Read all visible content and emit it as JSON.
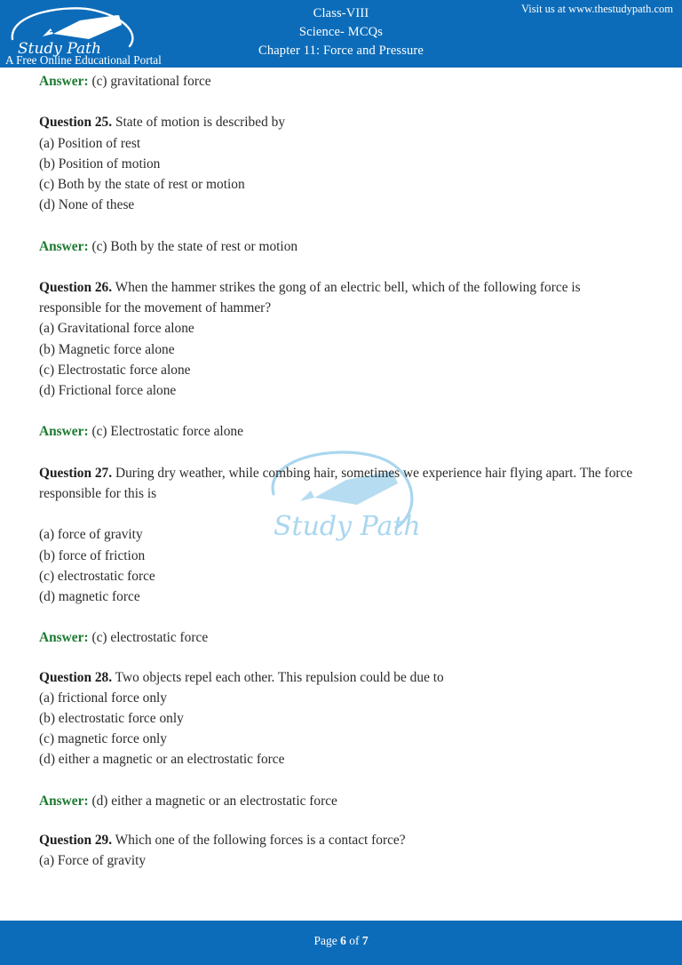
{
  "header": {
    "logo": {
      "brand": "Study Path",
      "tagline": "A Free Online Educational Portal",
      "icon": "pen-nib-icon"
    },
    "title_lines": [
      "Class-VIII",
      "Science- MCQs",
      "Chapter 11: Force and Pressure"
    ],
    "visit": "Visit us at www.thestudypath.com",
    "background_color": "#0d6cb9"
  },
  "watermark": {
    "text": "Study Path",
    "color": "#a9d6ef"
  },
  "answer_label": "Answer:",
  "colors": {
    "answer_green": "#1d7a31",
    "header_blue": "#0d6cb9",
    "body_text": "#2b2b2b"
  },
  "content": {
    "top_answer": {
      "label": "Answer:",
      "text": "(c) gravitational force"
    },
    "questions": [
      {
        "number": "Question 25.",
        "text": "State of motion is described by",
        "extra_gap_before_options": false,
        "options": [
          "(a) Position of rest",
          "(b) Position of motion",
          "(c) Both by the state of rest or motion",
          "(d) None of these"
        ],
        "answer_label": "Answer:",
        "answer_text": "(c) Both by the state of rest or motion"
      },
      {
        "number": "Question 26.",
        "text": "When the hammer strikes the gong of an electric bell, which of the following force is responsible for the movement of hammer?",
        "extra_gap_before_options": false,
        "options": [
          "(a) Gravitational force alone",
          "(b) Magnetic force alone",
          "(c) Electrostatic force alone",
          "(d) Frictional force alone"
        ],
        "answer_label": "Answer:",
        "answer_text": "(c) Electrostatic force alone"
      },
      {
        "number": "Question 27.",
        "text": "During dry weather, while combing hair, sometimes we experience hair flying apart. The force responsible for this is",
        "extra_gap_before_options": true,
        "options": [
          "(a) force of gravity",
          "(b) force of friction",
          "(c) electrostatic force",
          "(d) magnetic force"
        ],
        "answer_label": "Answer:",
        "answer_text": "(c) electrostatic force"
      },
      {
        "number": "Question 28.",
        "text": "Two objects repel each other. This repulsion could be due to",
        "extra_gap_before_options": false,
        "options": [
          "(a) frictional force only",
          "(b) electrostatic force only",
          "(c) magnetic force only",
          "(d) either a magnetic or an electrostatic force"
        ],
        "answer_label": "Answer:",
        "answer_text": "(d) either a magnetic or an electrostatic force"
      },
      {
        "number": "Question 29.",
        "text": "Which one of the following forces is a contact force?",
        "extra_gap_before_options": false,
        "options": [
          "(a) Force of gravity"
        ],
        "answer_label": null,
        "answer_text": null
      }
    ]
  },
  "footer": {
    "prefix": "Page ",
    "current_page": "6",
    "middle": " of ",
    "total_pages": "7",
    "background_color": "#0d6cb9"
  }
}
